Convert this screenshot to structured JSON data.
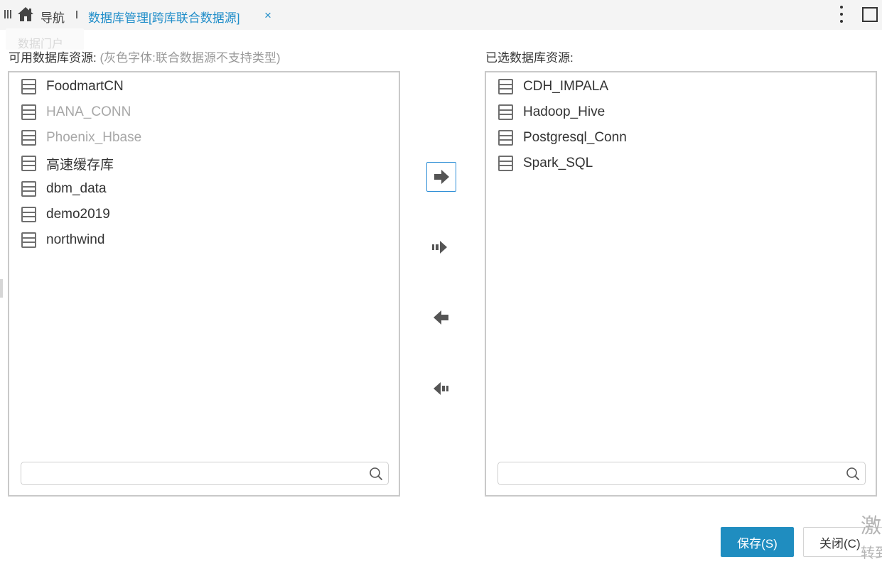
{
  "topbar": {
    "nav_label": "导航",
    "tab_title": "数据库管理[跨库联合数据源]",
    "tab_close": "×"
  },
  "ghost_tab": {
    "label": "数据门户"
  },
  "left_panel": {
    "heading": "可用数据库资源:",
    "hint": "(灰色字体:联合数据源不支持类型)",
    "items": [
      {
        "name": "FoodmartCN",
        "disabled": false
      },
      {
        "name": "HANA_CONN",
        "disabled": true
      },
      {
        "name": "Phoenix_Hbase",
        "disabled": true
      },
      {
        "name": "高速缓存库",
        "disabled": false
      },
      {
        "name": "dbm_data",
        "disabled": false
      },
      {
        "name": "demo2019",
        "disabled": false
      },
      {
        "name": "northwind",
        "disabled": false
      }
    ],
    "search_value": ""
  },
  "right_panel": {
    "heading": "已选数据库资源:",
    "items": [
      {
        "name": "CDH_IMPALA"
      },
      {
        "name": "Hadoop_Hive"
      },
      {
        "name": "Postgresql_Conn"
      },
      {
        "name": "Spark_SQL"
      }
    ],
    "search_value": ""
  },
  "footer": {
    "save_label": "保存(S)",
    "close_label": "关闭(C)",
    "watermark_line1": "激",
    "watermark_line2": "转到"
  },
  "colors": {
    "accent": "#1f8dc9",
    "save_button": "#1f8dc0",
    "disabled_text": "#a8a8a8",
    "arrow": "#555555"
  }
}
